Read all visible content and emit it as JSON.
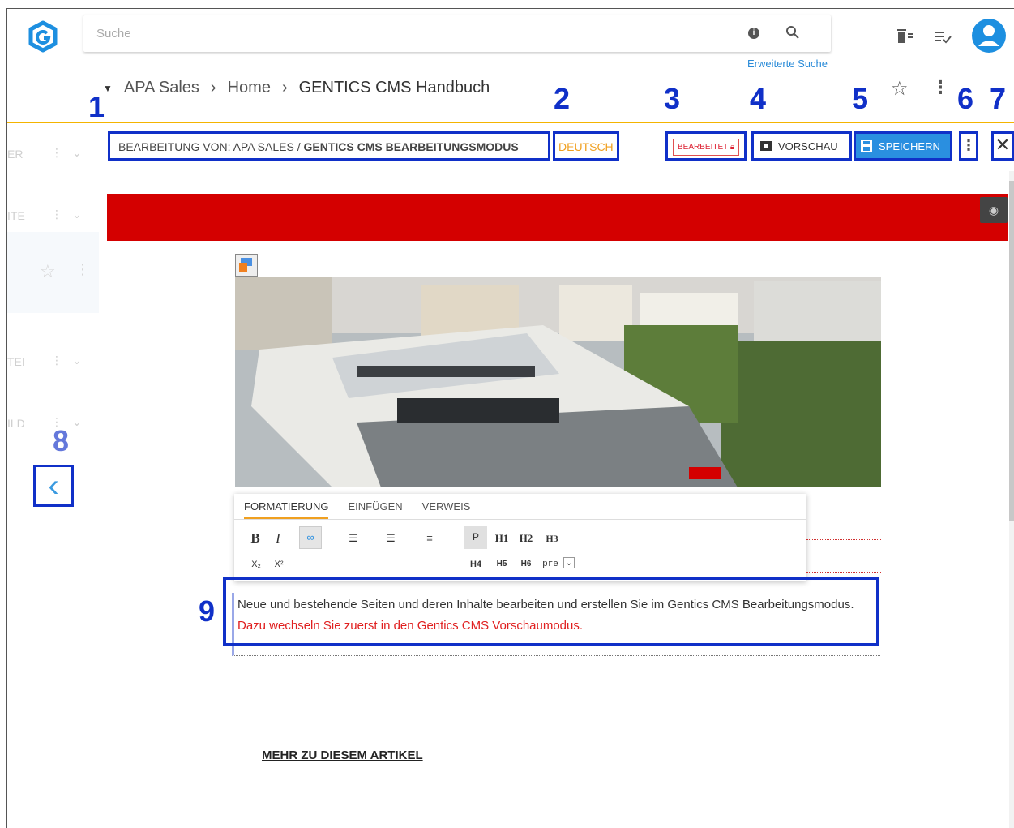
{
  "search": {
    "placeholder": "Suche",
    "advanced_label": "Erweiterte Suche"
  },
  "breadcrumb": {
    "items": [
      "APA Sales",
      "Home",
      "GENTICS CMS Handbuch"
    ]
  },
  "annotations": [
    "1",
    "2",
    "3",
    "4",
    "5",
    "6",
    "7",
    "8",
    "9"
  ],
  "sidebar": {
    "items": [
      "ER",
      "ITE",
      "TEI",
      "ILD"
    ]
  },
  "editbar": {
    "title_prefix": "BEARBEITUNG VON: APA SALES / ",
    "title_bold": "GENTICS CMS BEARBEITUNGSMODUS",
    "language": "DEUTSCH",
    "status_badge": "BEARBEITET",
    "preview_label": "VORSCHAU",
    "save_label": "SPEICHERN"
  },
  "editor_toolbar": {
    "tabs": [
      "FORMATIERUNG",
      "EINFÜGEN",
      "VERWEIS"
    ],
    "format_buttons": [
      "B",
      "I"
    ],
    "heading_buttons": [
      "P",
      "H1",
      "H2",
      "H3",
      "H4",
      "H5",
      "H6",
      "pre"
    ]
  },
  "content": {
    "paragraph_normal": "Neue und bestehende Seiten und deren Inhalte bearbeiten und erstellen Sie im Gentics CMS Bearbeitungsmodus. ",
    "paragraph_red": "Dazu wechseln Sie zuerst in den Gentics CMS Vorschaumodus.",
    "more_link": "MEHR ZU DIESEM ARTIKEL"
  },
  "colors": {
    "accent": "#2a8fe0",
    "annotation": "#1030c8",
    "brand_red": "#d40000",
    "orange": "#f4b400"
  }
}
